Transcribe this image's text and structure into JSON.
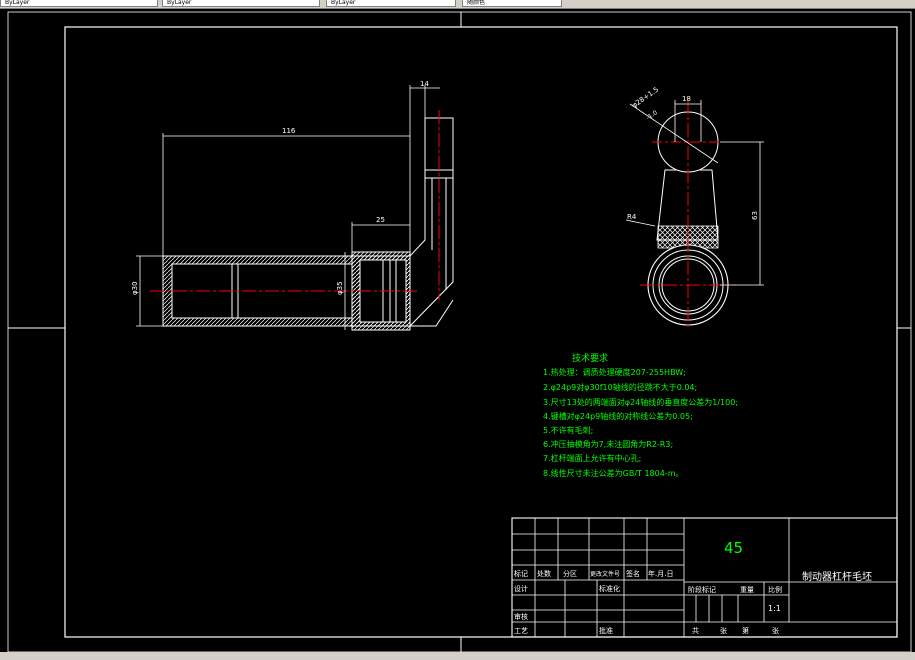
{
  "toolbar": {
    "tabs": [
      "ByLayer",
      "ByLayer",
      "ByLayer",
      "随颜色"
    ]
  },
  "dimensions": {
    "d14": "14",
    "d116": "116",
    "d25": "25",
    "d30": "φ30",
    "d35": "φ35",
    "d18": "18",
    "d28": "φ28+1.5",
    "d28tol": "-1.0",
    "d63": "63",
    "r4": "R4"
  },
  "notes": {
    "title": "技术要求",
    "lines": [
      "1.热处理：调质处理硬度207-255HBW;",
      "2.φ24p9对φ30f10轴线的径跳不大于0.04;",
      "3.尺寸13处的两端面对φ24轴线的垂直度公差为1/100;",
      "4.键槽对φ24p9轴线的对称线公差为0.05;",
      "5.不许有毛刺;",
      "6.冲压抽模角为7,未注圆角为R2-R3;",
      "7.杠杆端面上允许有中心孔;",
      "8.线性尺寸未注公差为GB/T 1804-m。"
    ]
  },
  "title_block": {
    "material": "45",
    "part_name": "制动器杠杆毛坯",
    "header_labels": [
      "标记",
      "处数",
      "分区",
      "更改文件号",
      "签名",
      "年.月.日"
    ],
    "design": "设计",
    "standardize": "标准化",
    "review": "审核",
    "process": "工艺",
    "approve": "批准",
    "stage_label": "阶段标记",
    "weight_label": "重量",
    "scale_label": "比例",
    "scale": "1:1",
    "total_label": "共",
    "sheets_label": "张",
    "sheet_label": "第",
    "sheets_label2": "张"
  },
  "colors": {
    "background": "#000000",
    "outline": "#ffffff",
    "dimension": "#ffffff",
    "centerline": "#ff0000",
    "notes": "#00ff00",
    "hidden": "#00ffff",
    "hatch": "#ffffff"
  }
}
